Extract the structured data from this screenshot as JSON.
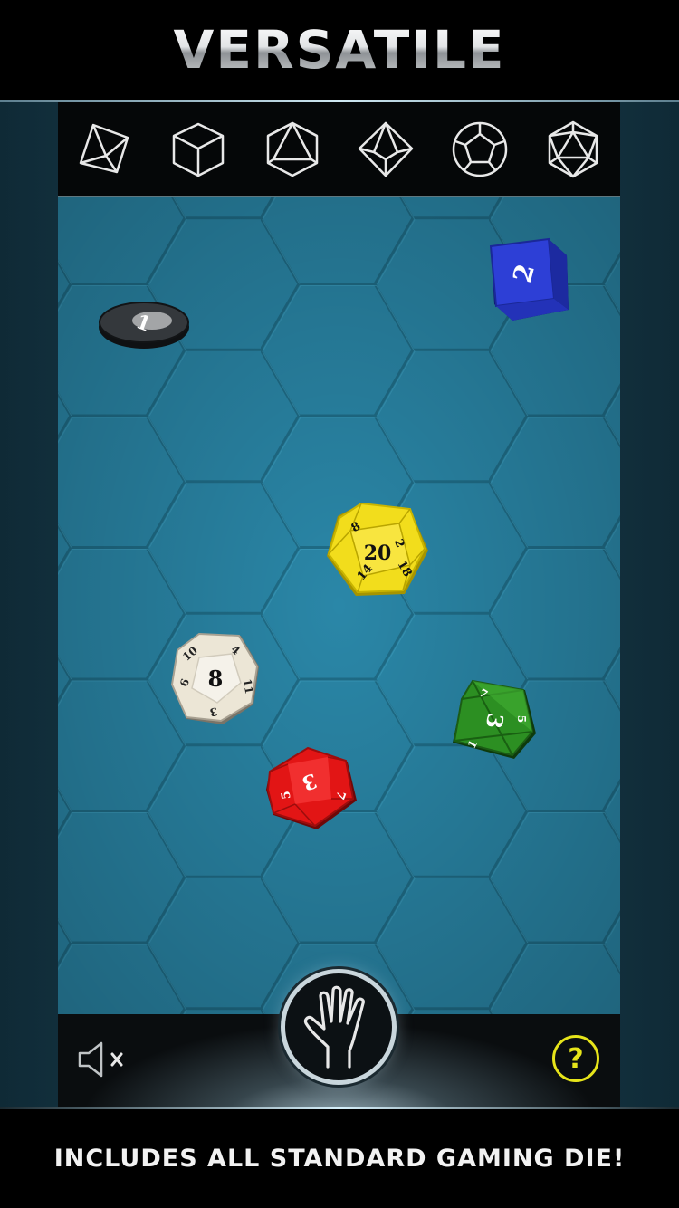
{
  "header": {
    "title": "VERSATILE"
  },
  "die_selector": [
    {
      "name": "d4-button",
      "icon": "d4-icon"
    },
    {
      "name": "d6-button",
      "icon": "d6-icon"
    },
    {
      "name": "d8-button",
      "icon": "d8-icon"
    },
    {
      "name": "d10-button",
      "icon": "d10-icon"
    },
    {
      "name": "d12-button",
      "icon": "d12-icon"
    },
    {
      "name": "d20-button",
      "icon": "d20-icon"
    }
  ],
  "dice": {
    "coin": {
      "face": "1",
      "color": "#2a2d30"
    },
    "d6": {
      "face": "2",
      "color": "#2d3fd6"
    },
    "d20": {
      "face": "20",
      "side_faces": [
        "8",
        "2",
        "14",
        "18"
      ],
      "color": "#f2dd1c"
    },
    "d12": {
      "face": "8",
      "side_faces": [
        "4",
        "11",
        "6",
        "3",
        "10"
      ],
      "color": "#ece6d6"
    },
    "d8": {
      "face": "3",
      "side_faces": [
        "1",
        "5",
        "7"
      ],
      "color": "#2c8f22"
    },
    "d10": {
      "face": "3",
      "side_faces": [
        "5",
        "7"
      ],
      "color": "#e21515"
    }
  },
  "controls": {
    "mute_icon": "speaker-muted-icon",
    "roll_icon": "hand-icon",
    "help_label": "?",
    "help_color": "#e6e41a"
  },
  "footer": {
    "text": "INCLUDES ALL STANDARD GAMING DIE!"
  }
}
